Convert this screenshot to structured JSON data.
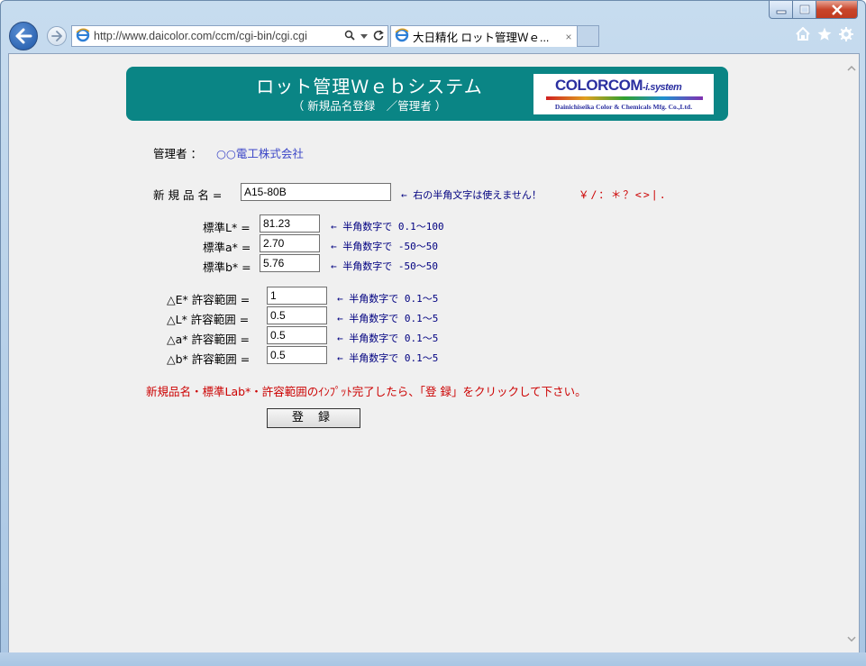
{
  "browser": {
    "url": "http://www.daicolor.com/ccm/cgi-bin/cgi.cgi",
    "tab_title": "大日精化 ロット管理Ｗｅ...",
    "tab_close": "×"
  },
  "header": {
    "title": "ロット管理Ｗｅｂシステム",
    "subtitle": "（ 新規品名登録　／管理者 ）",
    "logo": {
      "main": "COLORCOM",
      "suffix": "-i.system",
      "sub": "Dainichiseika Color & Chemicals Mfg. Co.,Ltd."
    }
  },
  "admin": {
    "label": "管理者 ：",
    "value": "○○電工株式会社"
  },
  "product": {
    "label": "新 規 品 名 =",
    "value": "A15-80B",
    "hint": "← 右の半角文字は使えません！",
    "forbidden_chars": "￥/：＊？<>|."
  },
  "standards": [
    {
      "label": "標準L* =",
      "value": "81.23",
      "hint": "← 半角数字で 0.1～100"
    },
    {
      "label": "標準a* =",
      "value": "2.70",
      "hint": "← 半角数字で -50～50"
    },
    {
      "label": "標準b* =",
      "value": "5.76",
      "hint": "← 半角数字で -50～50"
    }
  ],
  "tolerances": [
    {
      "label": "△E* 許容範囲 =",
      "value": "1",
      "hint": "← 半角数字で 0.1～5"
    },
    {
      "label": "△L* 許容範囲 =",
      "value": "0.5",
      "hint": "← 半角数字で 0.1～5"
    },
    {
      "label": "△a* 許容範囲 =",
      "value": "0.5",
      "hint": "← 半角数字で 0.1～5"
    },
    {
      "label": "△b* 許容範囲 =",
      "value": "0.5",
      "hint": "← 半角数字で 0.1～5"
    }
  ],
  "instruction": "新規品名・標準Lab*・許容範囲のｲﾝﾌﾟｯﾄ完了したら、「登 録」をクリックして下さい。",
  "register_label": "登 録",
  "colors": {
    "header_bg": "#0a8585",
    "accent_red": "#cc0000",
    "hint_blue": "#000080",
    "link_blue": "#3b46c7"
  }
}
